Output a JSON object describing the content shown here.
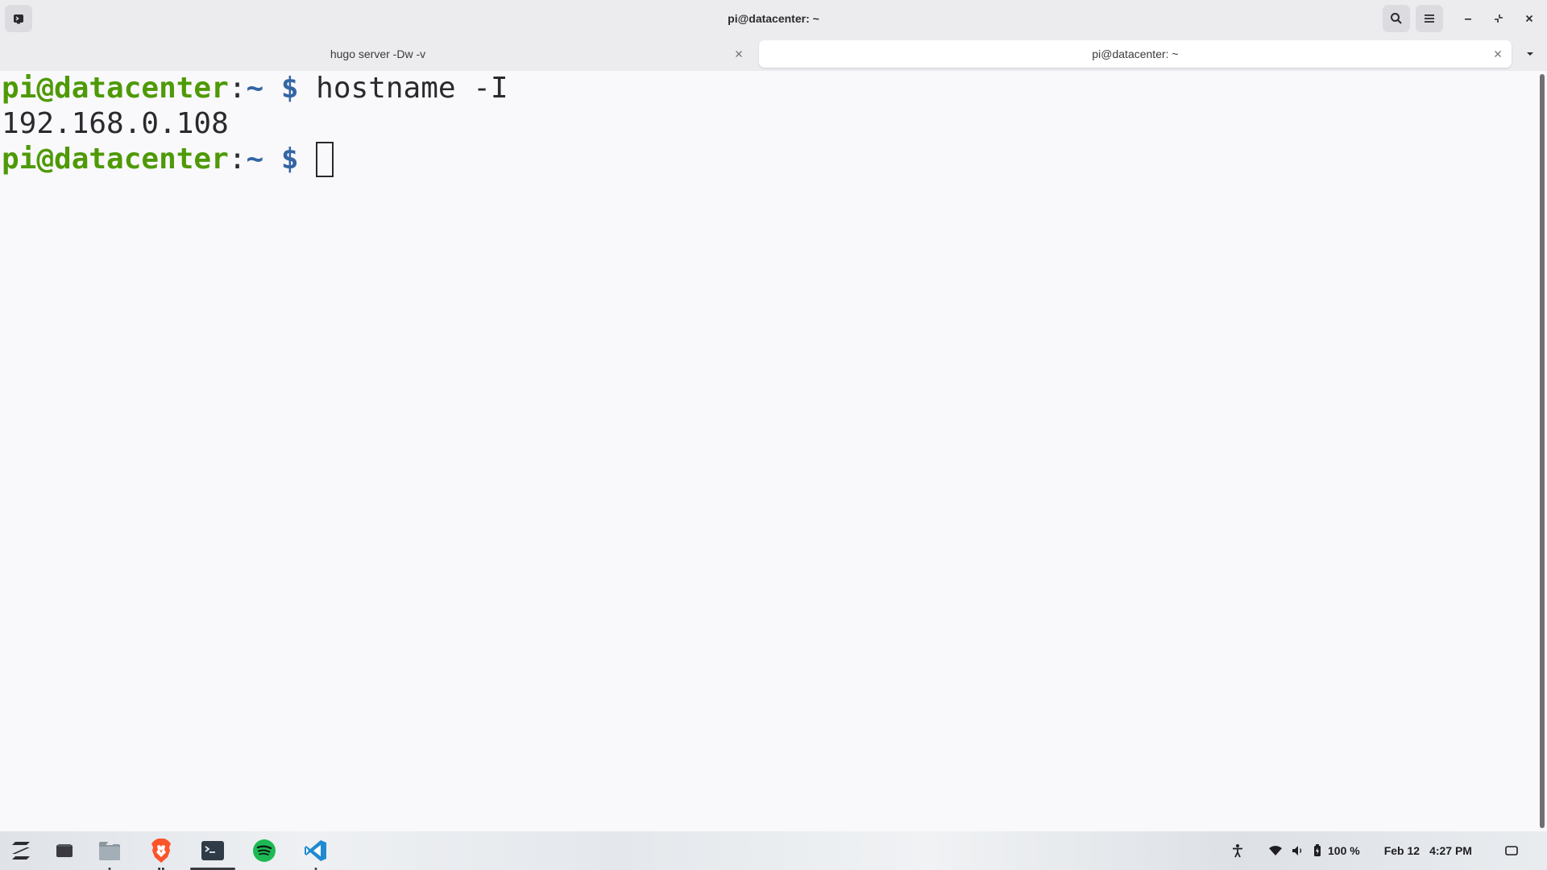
{
  "window": {
    "title": "pi@datacenter: ~"
  },
  "tabs": [
    {
      "label": "hugo server -Dw -v",
      "active": false
    },
    {
      "label": "pi@datacenter: ~",
      "active": true
    }
  ],
  "terminal": {
    "lines": [
      {
        "user": "pi@datacenter",
        "sep": ":",
        "path": "~",
        "dollar": " $ ",
        "command": "hostname -I"
      },
      {
        "output": "192.168.0.108"
      },
      {
        "user": "pi@datacenter",
        "sep": ":",
        "path": "~",
        "dollar": " $ ",
        "command": ""
      }
    ]
  },
  "taskbar": {
    "apps": [
      {
        "name": "zorin-menu-icon"
      },
      {
        "name": "workspace-icon"
      },
      {
        "name": "files-icon"
      },
      {
        "name": "brave-browser-icon"
      },
      {
        "name": "terminal-icon"
      },
      {
        "name": "spotify-icon"
      },
      {
        "name": "vscode-icon"
      }
    ],
    "battery": "100 %",
    "date": "Feb 12",
    "time": "4:27 PM"
  },
  "colors": {
    "prompt_user": "#4e9a06",
    "prompt_path": "#3465a4",
    "spotify": "#1db954",
    "vscode": "#1f8ad2",
    "brave": "#fb542b"
  }
}
